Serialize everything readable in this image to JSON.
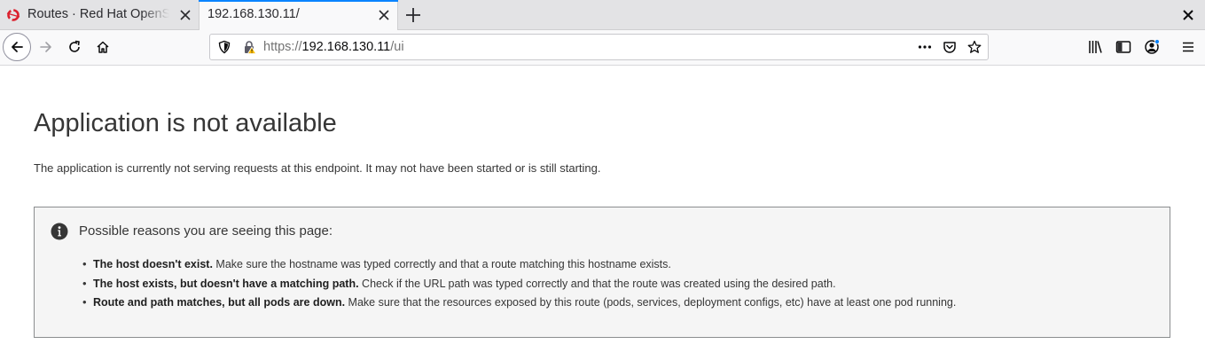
{
  "browser": {
    "tabs": [
      {
        "title": "Routes · Red Hat OpenShift",
        "active": false
      },
      {
        "title": "192.168.130.11/",
        "active": true
      }
    ],
    "url": {
      "scheme": "https://",
      "host": "192.168.130.11",
      "path": "/ui"
    },
    "accent_color": "#0a84ff"
  },
  "page": {
    "title": "Application is not available",
    "intro": "The application is currently not serving requests at this endpoint. It may not have been started or is still starting.",
    "alert": {
      "title": "Possible reasons you are seeing this page:",
      "reasons": [
        {
          "bold": "The host doesn't exist.",
          "text": " Make sure the hostname was typed correctly and that a route matching this hostname exists."
        },
        {
          "bold": "The host exists, but doesn't have a matching path.",
          "text": " Check if the URL path was typed correctly and that the route was created using the desired path."
        },
        {
          "bold": "Route and path matches, but all pods are down.",
          "text": " Make sure that the resources exposed by this route (pods, services, deployment configs, etc) have at least one pod running."
        }
      ]
    }
  }
}
